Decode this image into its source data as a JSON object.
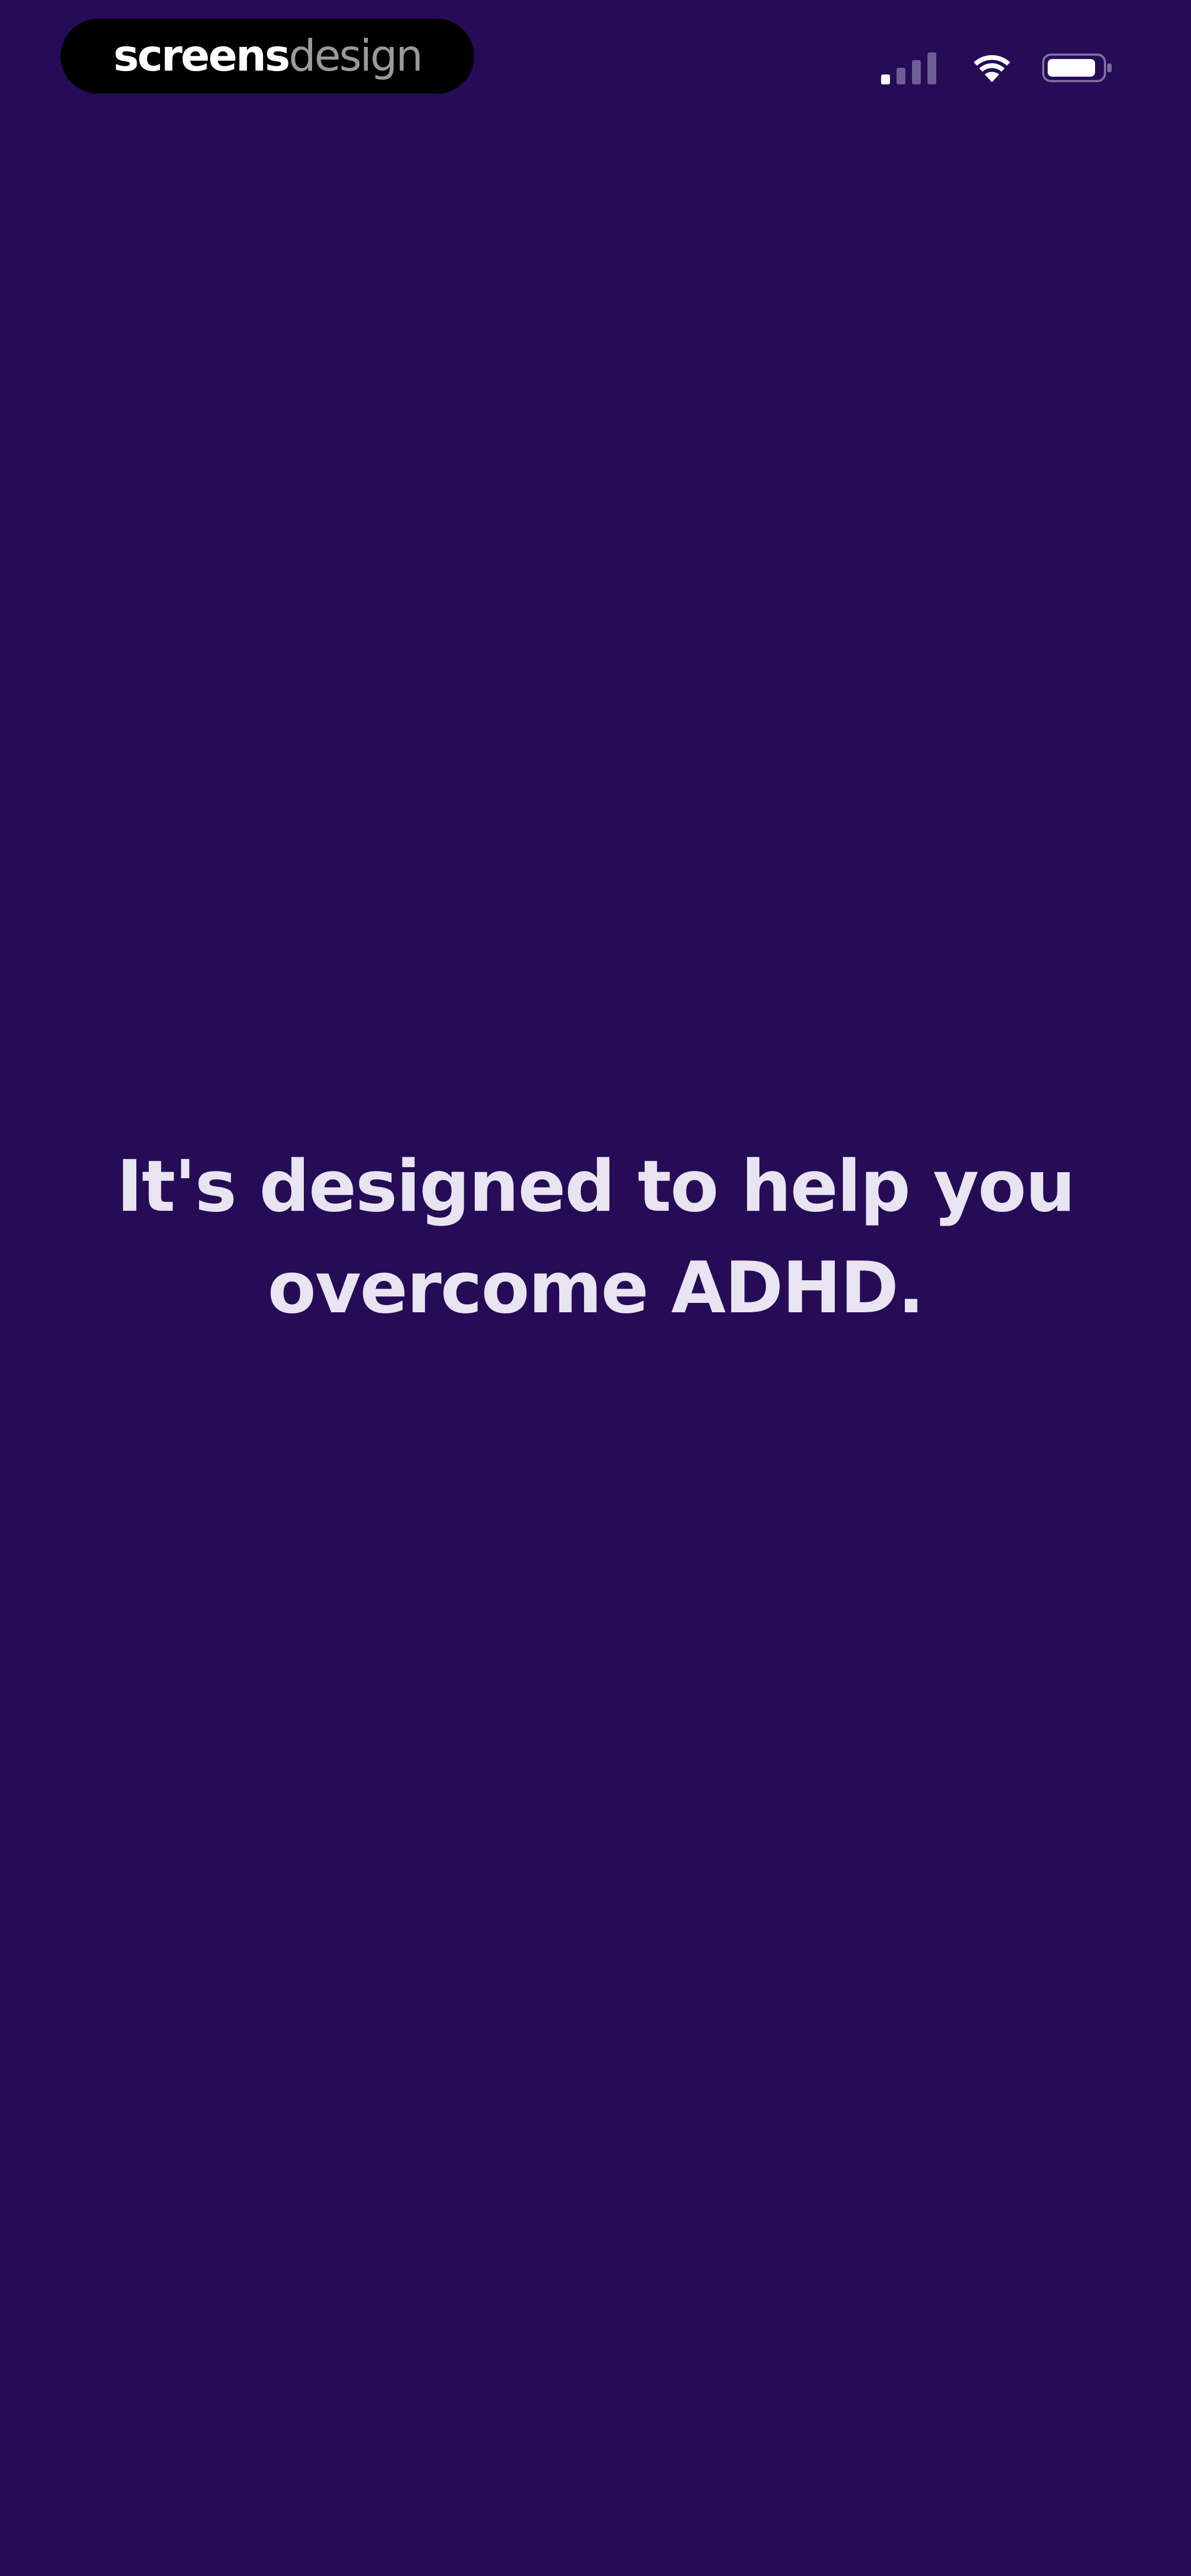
{
  "watermark": {
    "bold_text": "screens",
    "light_text": "design"
  },
  "status_bar": {
    "icons": [
      "cellular-signal-icon",
      "wifi-icon",
      "battery-icon"
    ]
  },
  "main": {
    "headline_line1": "It's designed to help you",
    "headline_line2": "overcome ADHD."
  },
  "colors": {
    "background": "#260c57",
    "text": "#e8e4f2"
  }
}
